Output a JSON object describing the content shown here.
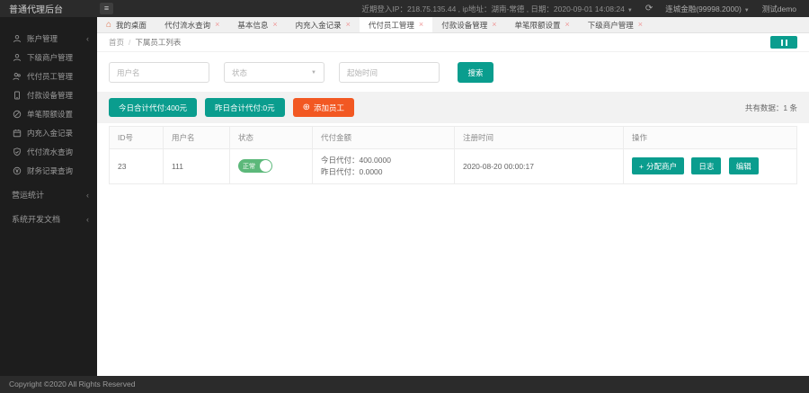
{
  "app": {
    "title": "普通代理后台",
    "footer": "Copyright ©2020 All Rights Reserved"
  },
  "topbar": {
    "login_info": "近期登入IP：218.75.135.44 , ip地址：湖南-常德 , 日期：2020-09-01 14:08:24",
    "merchant": "连城金融(99998.2000)",
    "user": "测试demo"
  },
  "icons": {
    "hamburger": "≡",
    "refresh": "⟳",
    "caret_down": "▼",
    "select_caret": "▼",
    "chevron_left": "‹",
    "close": "×",
    "home": "⌂",
    "plus": "+",
    "add_circle": "⊕"
  },
  "sidebar": {
    "items": [
      {
        "label": "账户管理",
        "icon": "user-icon"
      },
      {
        "label": "下级商户管理",
        "icon": "merchant-icon"
      },
      {
        "label": "代付员工管理",
        "icon": "users-icon"
      },
      {
        "label": "付款设备管理",
        "icon": "device-icon"
      },
      {
        "label": "单笔限额设置",
        "icon": "limit-icon"
      },
      {
        "label": "内充入金记录",
        "icon": "calendar-icon"
      },
      {
        "label": "代付流水查询",
        "icon": "shield-icon"
      },
      {
        "label": "财务记录查询",
        "icon": "money-icon"
      },
      {
        "label": "营运统计",
        "icon": ""
      },
      {
        "label": "系统开发文档",
        "icon": ""
      }
    ]
  },
  "tabs": [
    {
      "label": "我的桌面"
    },
    {
      "label": "代付流水查询"
    },
    {
      "label": "基本信息"
    },
    {
      "label": "内充入金记录"
    },
    {
      "label": "代付员工管理"
    },
    {
      "label": "付款设备管理"
    },
    {
      "label": "单笔限额设置"
    },
    {
      "label": "下级商户管理"
    }
  ],
  "breadcrumb": {
    "home": "首页",
    "separator": "/",
    "current": "下属员工列表"
  },
  "filters": {
    "username_placeholder": "用户名",
    "status_placeholder": "状态",
    "time_placeholder": "起始时间",
    "search_label": "搜索"
  },
  "summary": {
    "today_total": "今日合计代付:400元",
    "yesterday_total": "昨日合计代付:0元",
    "add_employee": "添加员工",
    "count_text": "共有数据：1 条"
  },
  "table": {
    "columns": [
      "ID号",
      "用户名",
      "状态",
      "代付金额",
      "注册时间",
      "操作"
    ],
    "row": {
      "id": "23",
      "username": "111",
      "status": "正常",
      "amount_today": "今日代付：400.0000",
      "amount_yesterday": "昨日代付：0.0000",
      "register_time": "2020-08-20 00:00:17",
      "action_assign": "分配商户",
      "action_log": "日志",
      "action_edit": "编辑"
    }
  },
  "colors": {
    "teal": "#0a9d8e",
    "orange": "#f25822",
    "toggle_green": "#5cb87a",
    "dark_bar": "#2b2b2b",
    "sidebar_bg": "#1d1d1d"
  }
}
